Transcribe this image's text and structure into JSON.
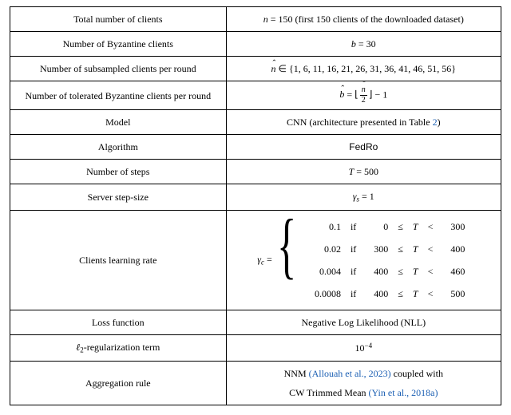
{
  "rows": {
    "total_clients": {
      "label": "Total number of clients",
      "value": "n = 150 (first 150 clients of the downloaded dataset)"
    },
    "byz_clients": {
      "label": "Number of Byzantine clients",
      "value": "b = 30"
    },
    "subsampled": {
      "label": "Number of subsampled clients per round",
      "value_set": "{1, 6, 11, 16, 21, 26, 31, 36, 41, 46, 51, 56}"
    },
    "tolerated": {
      "label": "Number of tolerated Byzantine clients per round"
    },
    "model": {
      "label": "Model",
      "value_prefix": "CNN (architecture presented in Table",
      "table_ref": "2",
      "value_suffix": ")"
    },
    "algorithm": {
      "label": "Algorithm",
      "value": "FedRo"
    },
    "steps": {
      "label": "Number of steps",
      "value": "T = 500"
    },
    "server_step": {
      "label": "Server step-size"
    },
    "client_lr": {
      "label": "Clients learning rate"
    },
    "loss": {
      "label": "Loss function",
      "value": "Negative Log Likelihood (NLL)"
    },
    "l2reg": {
      "label_prefix": "ℓ",
      "label_sub": "2",
      "label_suffix": "-regularization term"
    },
    "agg": {
      "label": "Aggregation rule",
      "line1_prefix": "NNM ",
      "line1_cite": "(Allouah et al., 2023)",
      "line1_suffix": " coupled with",
      "line2_prefix": "CW Trimmed Mean ",
      "line2_cite": "(Yin et al., 2018a)"
    }
  },
  "lr_schedule": [
    {
      "rate": "0.1",
      "lo": "0",
      "hi": "300"
    },
    {
      "rate": "0.02",
      "lo": "300",
      "hi": "400"
    },
    {
      "rate": "0.004",
      "lo": "400",
      "hi": "460"
    },
    {
      "rate": "0.0008",
      "lo": "400",
      "hi": "500"
    }
  ],
  "symbols": {
    "nhat_in": " ∈ ",
    "bhat_minus": " − 1",
    "gamma_s": " = 1",
    "gamma_c_eq": " = ",
    "if": "if",
    "le": "≤",
    "lt": "<",
    "T": "T",
    "ten_neg4_base": "10",
    "ten_neg4_exp": "−4",
    "frac_num": "n̂",
    "frac_den": "2"
  },
  "chart_data": {
    "type": "table",
    "title": "Experiment hyperparameters",
    "rows": [
      [
        "Total number of clients",
        "n = 150 (first 150 clients of the downloaded dataset)"
      ],
      [
        "Number of Byzantine clients",
        "b = 30"
      ],
      [
        "Number of subsampled clients per round",
        "n̂ ∈ {1, 6, 11, 16, 21, 26, 31, 36, 41, 46, 51, 56}"
      ],
      [
        "Number of tolerated Byzantine clients per round",
        "b̂ = ⌊ n̂ / 2 ⌋ − 1"
      ],
      [
        "Model",
        "CNN (architecture presented in Table 2)"
      ],
      [
        "Algorithm",
        "FedRo"
      ],
      [
        "Number of steps",
        "T = 500"
      ],
      [
        "Server step-size",
        "γ_s = 1"
      ],
      [
        "Clients learning rate",
        "γ_c = 0.1 if 0 ≤ T < 300; 0.02 if 300 ≤ T < 400; 0.004 if 400 ≤ T < 460; 0.0008 if 400 ≤ T < 500"
      ],
      [
        "Loss function",
        "Negative Log Likelihood (NLL)"
      ],
      [
        "ℓ2-regularization term",
        "10^-4"
      ],
      [
        "Aggregation rule",
        "NNM (Allouah et al., 2023) coupled with CW Trimmed Mean (Yin et al., 2018a)"
      ]
    ]
  }
}
